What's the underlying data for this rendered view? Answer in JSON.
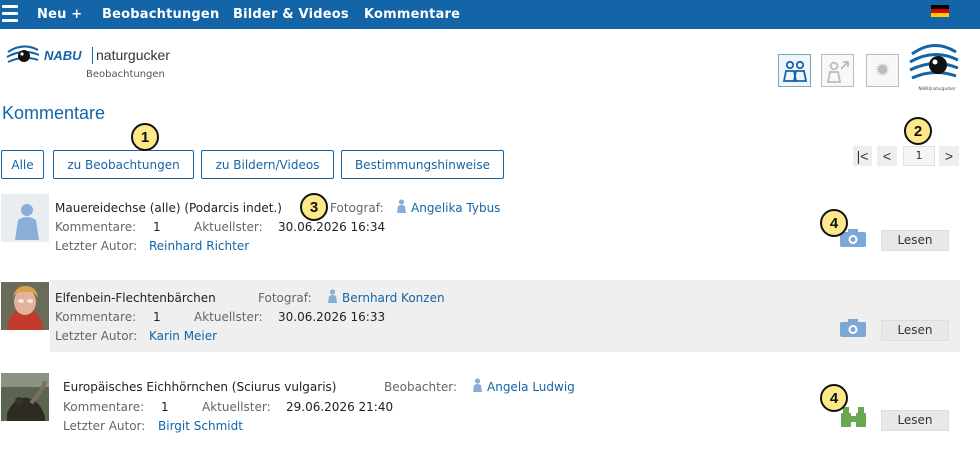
{
  "nav": {
    "items": [
      "Neu +",
      "Beobachtungen",
      "Bilder & Videos",
      "Kommentare"
    ],
    "flag": "german-flag-icon"
  },
  "logo": {
    "nabu": "NABU",
    "naturgucker": "naturgucker",
    "sub": "Beobachtungen",
    "eye_caption": "NABU|naturgucker"
  },
  "page_title": "Kommentare",
  "filters": [
    "Alle",
    "zu Beobachtungen",
    "zu Bildern/Videos",
    "Bestimmungshinweise"
  ],
  "pager": {
    "first": "|<",
    "prev": "<",
    "page": "1",
    "next": ">"
  },
  "annotations": [
    "1",
    "2",
    "3",
    "4",
    "4"
  ],
  "labels": {
    "kommentare": "Kommentare:",
    "aktuellster": "Aktuellster:",
    "letzter_autor": "Letzter Autor:",
    "lesen": "Lesen"
  },
  "rows": [
    {
      "title": "Mauereidechse (alle) (Podarcis indet.)",
      "role": "Fotograf:",
      "person": "Angelika Tybus",
      "count": "1",
      "date": "30.06.2026 16:34",
      "author": "Reinhard Richter",
      "type_icon": "camera-icon"
    },
    {
      "title": "Elfenbein-Flechtenbärchen",
      "role": "Fotograf:",
      "person": "Bernhard Konzen",
      "count": "1",
      "date": "30.06.2026 16:33",
      "author": "Karin Meier",
      "type_icon": "camera-icon"
    },
    {
      "title": "Europäisches Eichhörnchen (Sciurus vulgaris)",
      "role": "Beobachter:",
      "person": "Angela Ludwig",
      "count": "1",
      "date": "29.06.2026 21:40",
      "author": "Birgit Schmidt",
      "type_icon": "binoculars-icon"
    }
  ],
  "colors": {
    "brand": "#1464a8",
    "annotation": "#fde98a",
    "row_alt": "#efefef",
    "binoculars": "#6aa84f"
  }
}
